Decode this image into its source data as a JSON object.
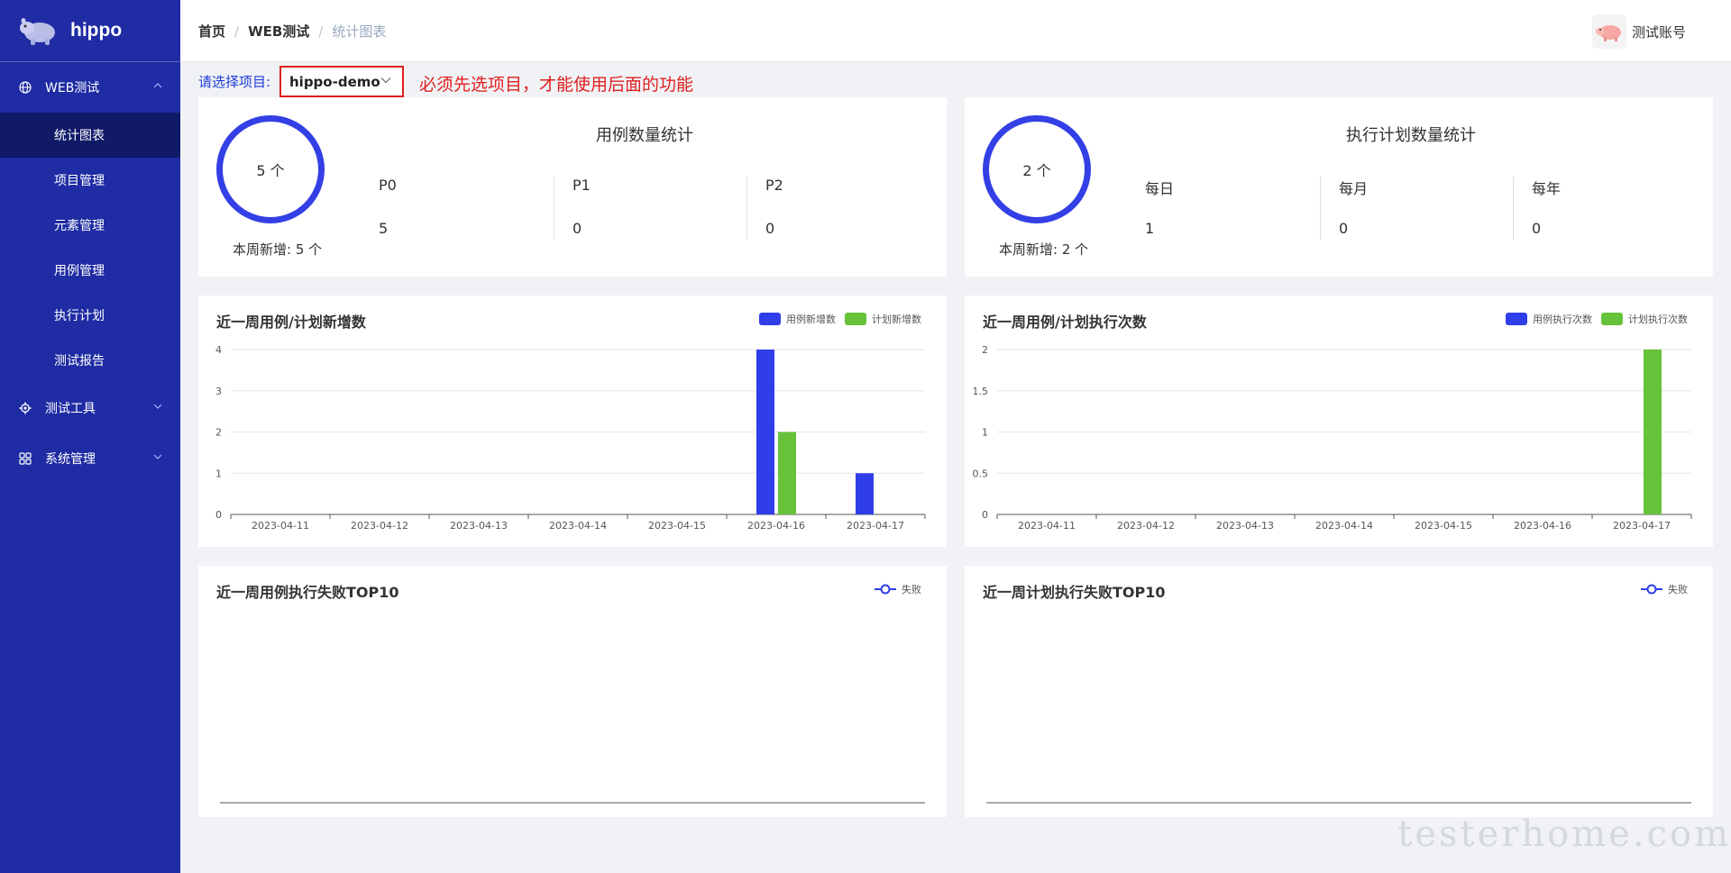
{
  "app": {
    "name": "hippo"
  },
  "sidebar": {
    "groups": [
      {
        "label": "WEB测试",
        "icon": "globe-icon",
        "expanded": true,
        "items": [
          "统计图表",
          "项目管理",
          "元素管理",
          "用例管理",
          "执行计划",
          "测试报告"
        ]
      },
      {
        "label": "测试工具",
        "icon": "gear-icon",
        "expanded": false
      },
      {
        "label": "系统管理",
        "icon": "grid-icon",
        "expanded": false
      }
    ],
    "active_item": "统计图表"
  },
  "header": {
    "breadcrumb": [
      "首页",
      "WEB测试",
      "统计图表"
    ],
    "account": "测试账号"
  },
  "project": {
    "label": "请选择项目:",
    "selected": "hippo-demo",
    "warning": "必须先选项目，才能使用后面的功能"
  },
  "case_stats": {
    "title": "用例数量统计",
    "total": "5 个",
    "week_new": "本周新增: 5 个",
    "columns": [
      {
        "key": "P0",
        "value": "5"
      },
      {
        "key": "P1",
        "value": "0"
      },
      {
        "key": "P2",
        "value": "0"
      }
    ]
  },
  "plan_stats": {
    "title": "执行计划数量统计",
    "total": "2 个",
    "week_new": "本周新增: 2 个",
    "columns": [
      {
        "key": "每日",
        "value": "1"
      },
      {
        "key": "每月",
        "value": "0"
      },
      {
        "key": "每年",
        "value": "0"
      }
    ]
  },
  "colors": {
    "blue": "#2f3ee8",
    "green": "#67c23a",
    "sidebar": "#1f2ca3",
    "warning": "#e02020"
  },
  "chart_data": [
    {
      "type": "bar",
      "title": "近一周用例/计划新增数",
      "categories": [
        "2023-04-11",
        "2023-04-12",
        "2023-04-13",
        "2023-04-14",
        "2023-04-15",
        "2023-04-16",
        "2023-04-17"
      ],
      "series": [
        {
          "name": "用例新增数",
          "values": [
            0,
            0,
            0,
            0,
            0,
            4,
            1
          ],
          "color": "#2f3ee8"
        },
        {
          "name": "计划新增数",
          "values": [
            0,
            0,
            0,
            0,
            0,
            2,
            0
          ],
          "color": "#67c23a"
        }
      ],
      "yticks": [
        "0",
        "1",
        "2",
        "3",
        "4"
      ],
      "ylim": [
        0,
        4
      ],
      "legend": "top-right",
      "grid": true
    },
    {
      "type": "bar",
      "title": "近一周用例/计划执行次数",
      "categories": [
        "2023-04-11",
        "2023-04-12",
        "2023-04-13",
        "2023-04-14",
        "2023-04-15",
        "2023-04-16",
        "2023-04-17"
      ],
      "series": [
        {
          "name": "用例执行次数",
          "values": [
            0,
            0,
            0,
            0,
            0,
            0,
            0
          ],
          "color": "#2f3ee8"
        },
        {
          "name": "计划执行次数",
          "values": [
            0,
            0,
            0,
            0,
            0,
            0,
            2
          ],
          "color": "#67c23a"
        }
      ],
      "yticks": [
        "0",
        "0.5",
        "1",
        "1.5",
        "2"
      ],
      "ylim": [
        0,
        2
      ],
      "legend": "top-right",
      "grid": true
    },
    {
      "type": "line",
      "title": "近一周用例执行失败TOP10",
      "categories": [],
      "series": [
        {
          "name": "失败",
          "values": [],
          "color": "#2f3ee8"
        }
      ],
      "legend": "top-right"
    },
    {
      "type": "line",
      "title": "近一周计划执行失败TOP10",
      "categories": [],
      "series": [
        {
          "name": "失败",
          "values": [],
          "color": "#2f3ee8"
        }
      ],
      "legend": "top-right"
    }
  ],
  "watermark": "testerhome.com"
}
